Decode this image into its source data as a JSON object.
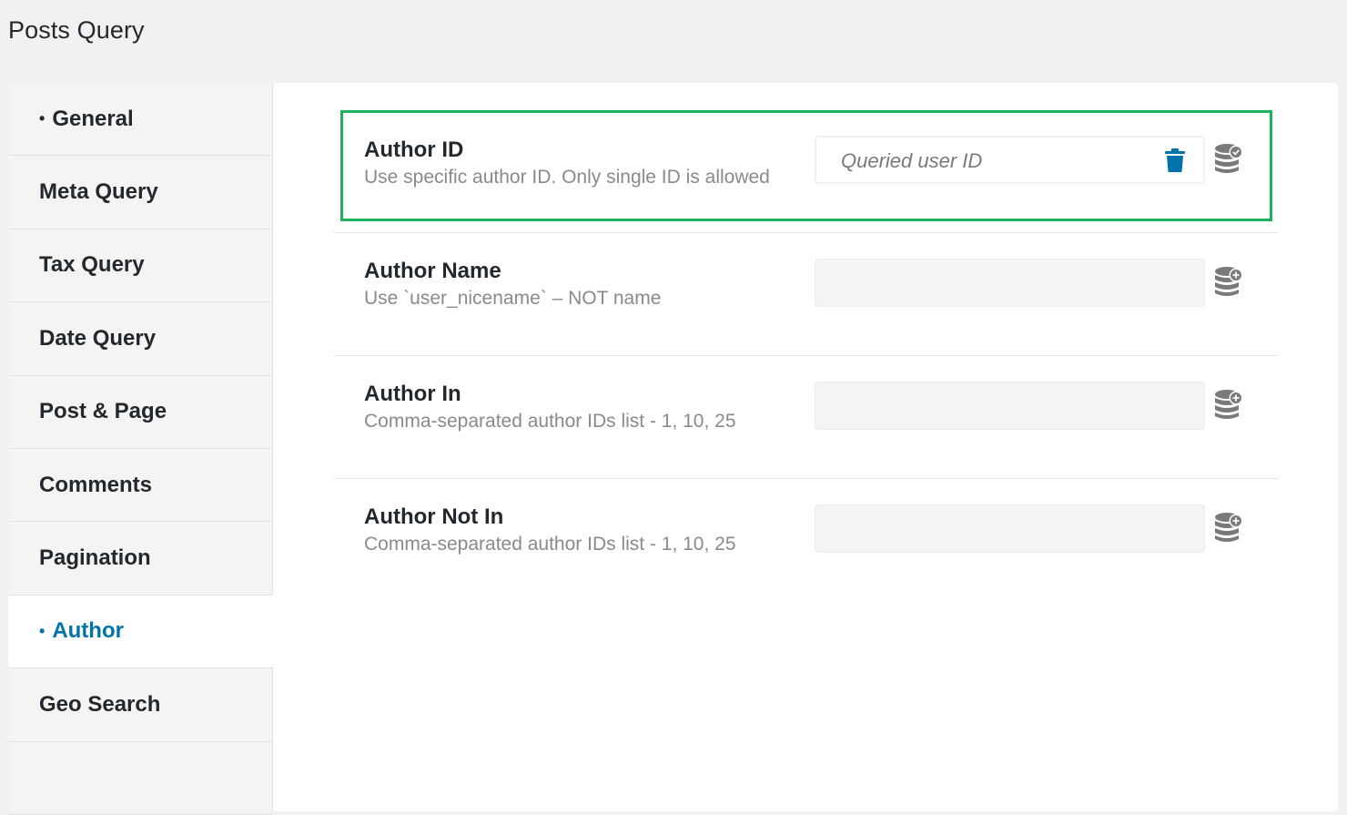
{
  "page": {
    "title": "Posts Query"
  },
  "sidebar": {
    "tabs": [
      {
        "label": "General",
        "bullet": "•",
        "active": false
      },
      {
        "label": "Meta Query",
        "bullet": "",
        "active": false
      },
      {
        "label": "Tax Query",
        "bullet": "",
        "active": false
      },
      {
        "label": "Date Query",
        "bullet": "",
        "active": false
      },
      {
        "label": "Post & Page",
        "bullet": "",
        "active": false
      },
      {
        "label": "Comments",
        "bullet": "",
        "active": false
      },
      {
        "label": "Pagination",
        "bullet": "",
        "active": false
      },
      {
        "label": "Author",
        "bullet": "•",
        "active": true
      },
      {
        "label": "Geo Search",
        "bullet": "",
        "active": false
      }
    ]
  },
  "fields": [
    {
      "label": "Author ID",
      "description": "Use specific author ID. Only single ID is allowed",
      "value": "Queried user ID",
      "has_delete": true,
      "dynamic_icon": "database-check-icon",
      "highlighted": true
    },
    {
      "label": "Author Name",
      "description": "Use `user_nicename` – NOT name",
      "value": "",
      "has_delete": false,
      "dynamic_icon": "database-plus-icon",
      "highlighted": false
    },
    {
      "label": "Author In",
      "description": "Comma-separated author IDs list - 1, 10, 25",
      "value": "",
      "has_delete": false,
      "dynamic_icon": "database-plus-icon",
      "highlighted": false
    },
    {
      "label": "Author Not In",
      "description": "Comma-separated author IDs list - 1, 10, 25",
      "value": "",
      "has_delete": false,
      "dynamic_icon": "database-plus-icon",
      "highlighted": false
    }
  ],
  "colors": {
    "accent": "#0073aa",
    "highlight_border": "#1db35b",
    "trash": "#0073aa",
    "icon_gray": "#7a7a7a"
  }
}
